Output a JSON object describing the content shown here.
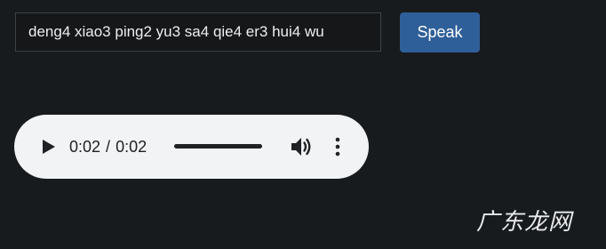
{
  "input": {
    "value": "deng4 xiao3 ping2 yu3 sa4 qie4 er3 hui4 wu",
    "placeholder": ""
  },
  "speak_button": {
    "label": "Speak"
  },
  "audio": {
    "current_time": "0:02",
    "separator": "/",
    "duration": "0:02",
    "progress": 1.0,
    "icons": {
      "play": "play-icon",
      "volume": "volume-icon",
      "more": "more-vertical-icon"
    }
  },
  "watermark": {
    "text": "广东龙网"
  },
  "colors": {
    "background": "#181b1e",
    "button": "#2f5f98",
    "player": "#f1f3f4"
  }
}
